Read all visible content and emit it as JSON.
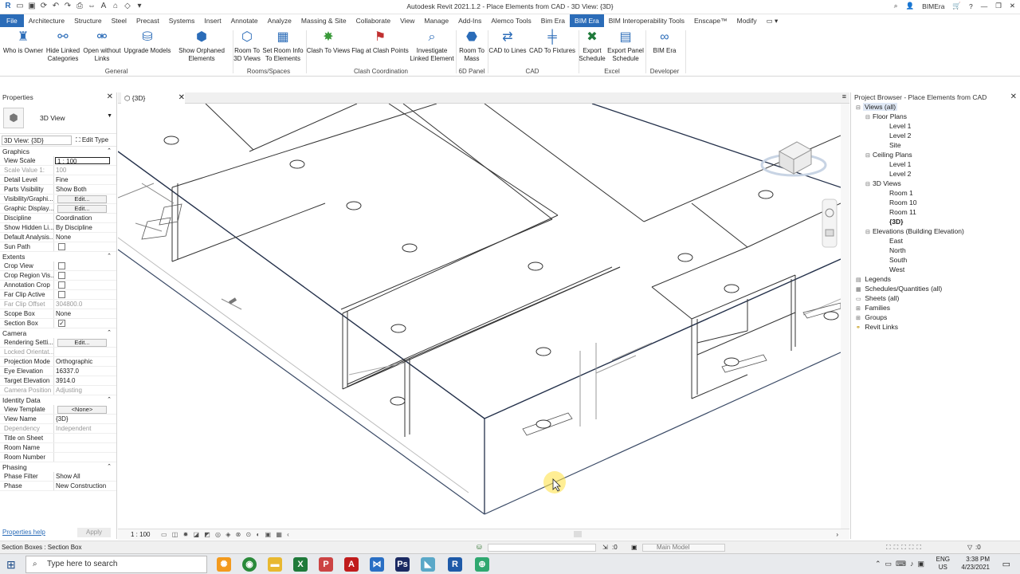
{
  "app": {
    "title": "Autodesk Revit 2021.1.2 - Place Elements from CAD - 3D View: {3D}",
    "user": "BIMEra"
  },
  "tabs": [
    "File",
    "Architecture",
    "Structure",
    "Steel",
    "Precast",
    "Systems",
    "Insert",
    "Annotate",
    "Analyze",
    "Massing & Site",
    "Collaborate",
    "View",
    "Manage",
    "Add-Ins",
    "Alemco Tools",
    "Bim Era",
    "BIM Era",
    "BIM Interoperability Tools",
    "Enscape™",
    "Modify"
  ],
  "ribbon": {
    "general": {
      "who": "Who is Owner",
      "hide": "Hide Linked Categories",
      "open": "Open without Links",
      "upgrade": "Upgrade Models",
      "show": "Show Orphaned Elements",
      "label": "General"
    },
    "rooms": {
      "room3d": "Room To 3D Views",
      "setroom": "Set Room Info To Elements",
      "label": "Rooms/Spaces"
    },
    "clash": {
      "c2v": "Clash To Views",
      "flag": "Flag at Clash Points",
      "inv": "Investigate Linked Element",
      "label": "Clash Coordination"
    },
    "sixd": {
      "r2m": "Room To Mass",
      "label": "6D Panel"
    },
    "cad": {
      "c2l": "CAD to Lines",
      "c2f": "CAD To Fixtures",
      "label": "CAD"
    },
    "excel": {
      "exs": "Export Schedule",
      "exp": "Export Panel Schedule",
      "label": "Excel"
    },
    "dev": {
      "bim": "BIM Era",
      "label": "Developer"
    }
  },
  "properties": {
    "title": "Properties",
    "type": "3D View",
    "selector": "3D View: {3D}",
    "edit_type": "Edit Type",
    "graphics": "Graphics",
    "view_scale": {
      "k": "View Scale",
      "v": "1 : 100"
    },
    "scale_value": {
      "k": "Scale Value 1:",
      "v": "100"
    },
    "detail": {
      "k": "Detail Level",
      "v": "Fine"
    },
    "parts": {
      "k": "Parts Visibility",
      "v": "Show Both"
    },
    "vis": {
      "k": "Visibility/Graphi...",
      "v": "Edit..."
    },
    "gdisp": {
      "k": "Graphic Display...",
      "v": "Edit..."
    },
    "disc": {
      "k": "Discipline",
      "v": "Coordination"
    },
    "hidden": {
      "k": "Show Hidden Li...",
      "v": "By Discipline"
    },
    "defan": {
      "k": "Default Analysis...",
      "v": "None"
    },
    "sun": {
      "k": "Sun Path"
    },
    "extents": "Extents",
    "crop": {
      "k": "Crop View"
    },
    "cropreg": {
      "k": "Crop Region Vis..."
    },
    "annot": {
      "k": "Annotation Crop"
    },
    "farclip": {
      "k": "Far Clip Active"
    },
    "faroff": {
      "k": "Far Clip Offset",
      "v": "304800.0"
    },
    "scope": {
      "k": "Scope Box",
      "v": "None"
    },
    "section": {
      "k": "Section Box"
    },
    "camera": "Camera",
    "render": {
      "k": "Rendering Setti...",
      "v": "Edit..."
    },
    "locked": {
      "k": "Locked Orientat..."
    },
    "proj": {
      "k": "Projection Mode",
      "v": "Orthographic"
    },
    "eye": {
      "k": "Eye Elevation",
      "v": "16337.0"
    },
    "target": {
      "k": "Target Elevation",
      "v": "3914.0"
    },
    "campos": {
      "k": "Camera Position",
      "v": "Adjusting"
    },
    "identity": "Identity Data",
    "vtemp": {
      "k": "View Template",
      "v": "<None>"
    },
    "vname": {
      "k": "View Name",
      "v": "{3D}"
    },
    "dep": {
      "k": "Dependency",
      "v": "Independent"
    },
    "tos": {
      "k": "Title on Sheet"
    },
    "rname": {
      "k": "Room Name"
    },
    "rnum": {
      "k": "Room Number"
    },
    "phasing": "Phasing",
    "pfilter": {
      "k": "Phase Filter",
      "v": "Show All"
    },
    "phase": {
      "k": "Phase",
      "v": "New Construction"
    },
    "help": "Properties help",
    "apply": "Apply"
  },
  "view": {
    "tab": "{3D}",
    "scale": "1 : 100"
  },
  "browser": {
    "title": "Project Browser - Place Elements from CAD",
    "items": [
      "Views (all)",
      "Floor Plans",
      "Level 1",
      "Level 2",
      "Site",
      "Ceiling Plans",
      "Level 1",
      "Level 2",
      "3D Views",
      "Room 1",
      "Room 10",
      "Room 11",
      "{3D}",
      "Elevations (Building Elevation)",
      "East",
      "North",
      "South",
      "West",
      "Legends",
      "Schedules/Quantities (all)",
      "Sheets (all)",
      "Families",
      "Groups",
      "Revit Links"
    ]
  },
  "status": {
    "text": "Section Boxes : Section Box",
    "model": "Main Model",
    "zero": ":0",
    "filter": ":0"
  },
  "taskbar": {
    "search": "Type here to search",
    "time": "3:38 PM",
    "date": "4/23/2021",
    "lang": "ENG",
    "region": "US"
  }
}
